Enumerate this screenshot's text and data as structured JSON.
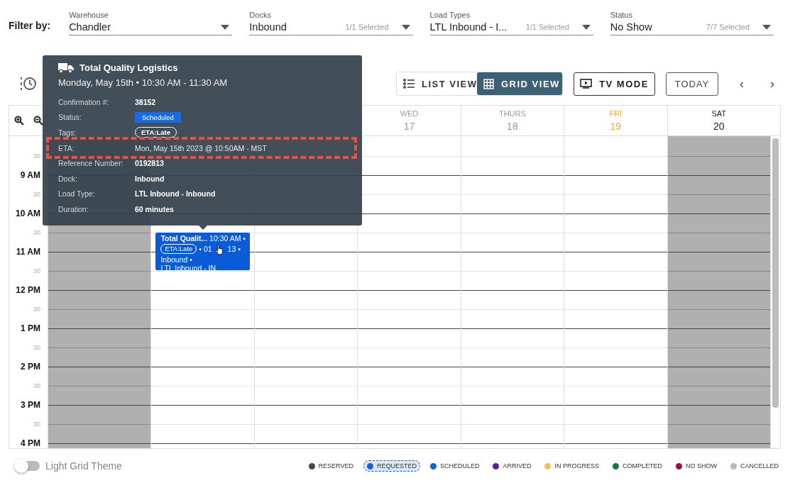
{
  "filter_bar": {
    "label": "Filter by:",
    "filters": [
      {
        "label": "Warehouse",
        "value": "Chandler"
      },
      {
        "label": "Docks",
        "value": "Inbound",
        "count": "1/1 Selected"
      },
      {
        "label": "Load Types",
        "value": "LTL Inbound - I...",
        "count": "1/1 Selected"
      },
      {
        "label": "Status",
        "value": "No Show",
        "count": "7/7 Selected"
      }
    ]
  },
  "toolbar": {
    "views": [
      {
        "label": "LIST VIEW",
        "kind": "list",
        "selected": false
      },
      {
        "label": "GRID VIEW",
        "kind": "grid",
        "selected": true
      }
    ],
    "tv_mode": "TV MODE",
    "today": "TODAY",
    "prev": "‹",
    "next": "›"
  },
  "calendar": {
    "days": [
      {
        "kind": "past",
        "closed": true
      },
      {
        "kind": "past",
        "closed": false,
        "appointment": {
          "title": "Total Qualit...",
          "time": "10:30 AM •",
          "tag": "ETA:Late",
          "reference_start": "• 01",
          "reference_end": "13 •",
          "dock": "Inbound •",
          "load_type": "LTL Inbound - IN",
          "color": "#0a5bd8"
        }
      },
      {
        "kind": "past",
        "closed": false
      },
      {
        "label": "WED",
        "date": "17",
        "kind": "past",
        "closed": false
      },
      {
        "label": "THURS",
        "date": "18",
        "kind": "past",
        "closed": false
      },
      {
        "label": "FRI",
        "date": "19",
        "kind": "today",
        "closed": false
      },
      {
        "label": "SAT",
        "date": "20",
        "kind": "future",
        "closed": true
      }
    ],
    "times": [
      {
        "label": "30",
        "kind": "half"
      },
      {
        "label": "9 AM",
        "kind": "hour"
      },
      {
        "label": "30",
        "kind": "half"
      },
      {
        "label": "10 AM",
        "kind": "hour"
      },
      {
        "label": "30",
        "kind": "half"
      },
      {
        "label": "11 AM",
        "kind": "hour"
      },
      {
        "label": "30",
        "kind": "half"
      },
      {
        "label": "12 PM",
        "kind": "hour"
      },
      {
        "label": "30",
        "kind": "half"
      },
      {
        "label": "1 PM",
        "kind": "hour"
      },
      {
        "label": "30",
        "kind": "half"
      },
      {
        "label": "2 PM",
        "kind": "hour"
      },
      {
        "label": "30",
        "kind": "half"
      },
      {
        "label": "3 PM",
        "kind": "hour"
      },
      {
        "label": "30",
        "kind": "half"
      },
      {
        "label": "4 PM",
        "kind": "hour"
      }
    ]
  },
  "tooltip": {
    "carrier": "Total Quality Logistics",
    "when": "Monday, May 15th • 10:30 AM - 11:30 AM",
    "fields": [
      {
        "label": "Confirmation #:",
        "value": "38152",
        "kind": "text",
        "highlighted": false
      },
      {
        "label": "Status:",
        "value": "Scheduled",
        "kind": "status",
        "highlighted": false
      },
      {
        "label": "Tags:",
        "value": "ETA:Late",
        "kind": "tag",
        "highlighted": false
      },
      {
        "label": "ETA:",
        "value": "Mon, May 15th 2023 @ 10:50AM - MST",
        "kind": "text",
        "highlighted": true
      },
      {
        "label": "Reference Number:",
        "value": "0192813",
        "kind": "text",
        "highlighted": false
      },
      {
        "label": "Dock:",
        "value": "Inbound",
        "kind": "text",
        "highlighted": false
      },
      {
        "label": "Load Type:",
        "value": "LTL Inbound - Inbound",
        "kind": "text",
        "highlighted": false
      },
      {
        "label": "Duration:",
        "value": "60 minutes",
        "kind": "text",
        "highlighted": false
      }
    ]
  },
  "theme_toggle": {
    "label": "Light Grid Theme",
    "on": false
  },
  "legend": [
    {
      "label": "RESERVED",
      "color": "#3d4b55",
      "selected": false
    },
    {
      "label": "REQUESTED",
      "color": "#1a5fd6",
      "selected": true
    },
    {
      "label": "SCHEDULED",
      "color": "#0a63e0",
      "selected": false
    },
    {
      "label": "ARRIVED",
      "color": "#5b1a9a",
      "selected": false
    },
    {
      "label": "IN PROGRESS",
      "color": "#f5c05a",
      "selected": false
    },
    {
      "label": "COMPLETED",
      "color": "#0f7a3e",
      "selected": false
    },
    {
      "label": "NO SHOW",
      "color": "#a3102e",
      "selected": false
    },
    {
      "label": "CANCELLED",
      "color": "#b8b8b8",
      "selected": false
    }
  ]
}
